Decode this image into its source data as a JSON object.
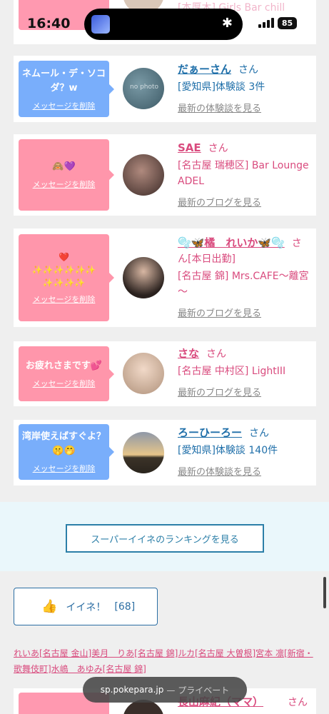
{
  "status": {
    "time": "16:40",
    "battery": "85",
    "bt": "✱"
  },
  "top_partial": {
    "text": "[本厚木] Girls Bar chill"
  },
  "cards": [
    {
      "msg_text": "ネムール・デ・ソコダ？w",
      "msg_delete": "メッセージを削除",
      "name": "だぁーさん",
      "san": "さん",
      "location": "[愛知県]体験談 3件",
      "latest": "最新の体験談を見る",
      "avatar_note": "no photo"
    },
    {
      "msg_text": "🙈💜",
      "msg_delete": "メッセージを削除",
      "name": "SAE",
      "san": "さん",
      "location": "[名古屋 瑞穂区] Bar Lounge ADEL",
      "latest": "最新のブログを見る"
    },
    {
      "msg_text": "❤️\n✨✨✨✨✨✨\n✨✨✨✨",
      "msg_delete": "メッセージを削除",
      "name": "🫧🦋橘　れいか🦋🫧",
      "san": "さん[本日出勤]",
      "location": "[名古屋 錦] Mrs.CAFE～離宮～",
      "latest": "最新のブログを見る"
    },
    {
      "msg_text": "お疲れさまです💕",
      "msg_delete": "メッセージを削除",
      "name": "さな",
      "san": "さん",
      "location": "[名古屋 中村区] LightIII",
      "latest": "最新のブログを見る"
    },
    {
      "msg_text": "湾岸使えばすぐよ？🤫🤭",
      "msg_delete": "メッセージを削除",
      "name": "ろーひーろー",
      "san": "さん",
      "location": "[愛知県]体験談 140件",
      "latest": "最新の体験談を見る"
    }
  ],
  "ranking_button": "スーパーイイネのランキングを見る",
  "like_button": {
    "label": "イイネ！",
    "count": "[68]"
  },
  "likers_text": "れいあ[名古屋 金山]美月　りあ[名古屋 錦]ルカ[名古屋 大曽根]宮本 凛[新宿・歌舞伎町]水嶋　あゆみ[名古屋 錦]",
  "bottom_partial": {
    "name": "長山麻紀（ママ）",
    "san": "さん"
  },
  "url_pill": {
    "host": "sp.pokepara.jp",
    "suffix": "— プライベート"
  },
  "colors": {
    "blue_bubble": "#79aefb",
    "pink_bubble": "#ff96ab",
    "link_blue": "#1f6fa9",
    "link_pink": "#d94b7e"
  }
}
